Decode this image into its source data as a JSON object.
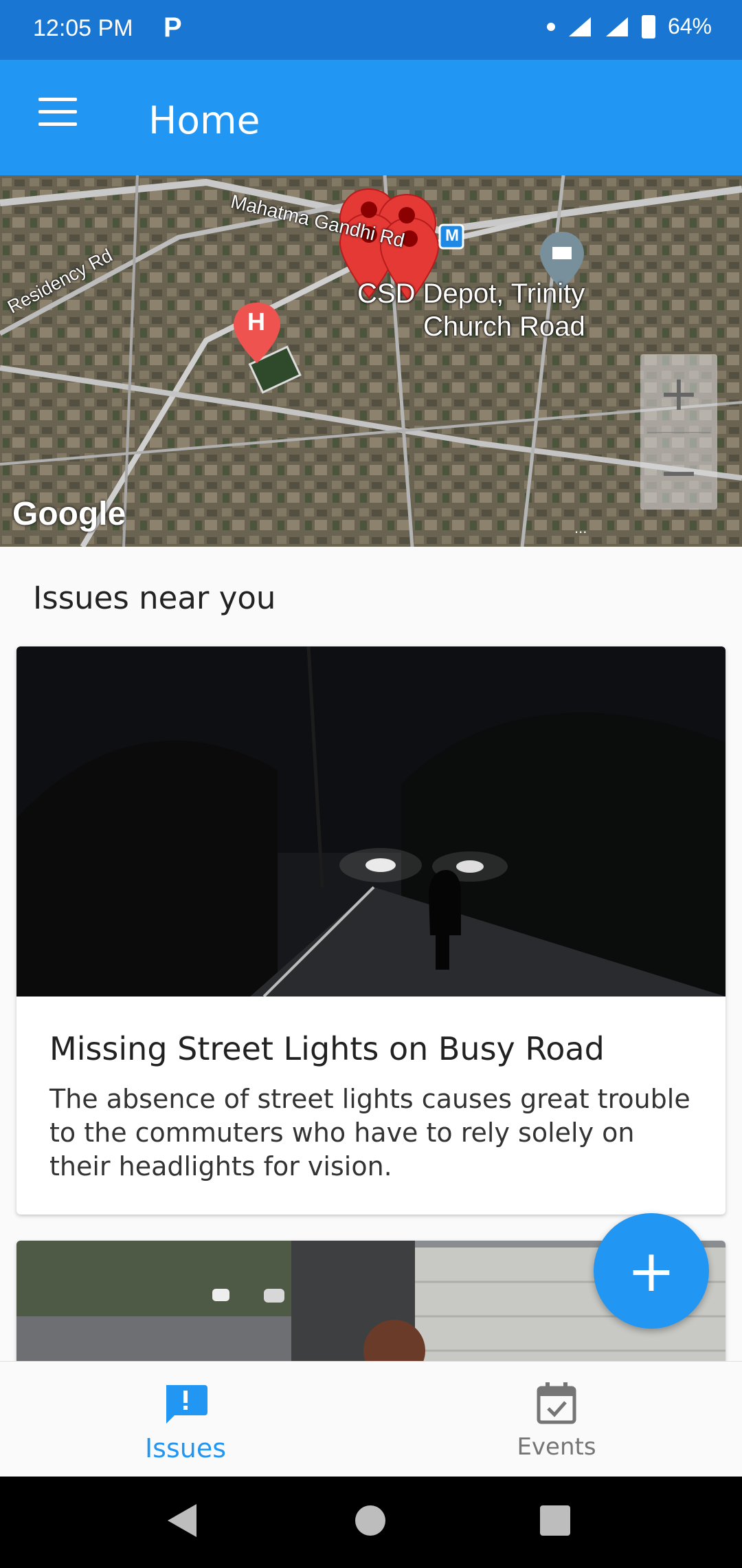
{
  "status_bar": {
    "time": "12:05 PM",
    "app_icon": "P",
    "battery": "64%"
  },
  "app_bar": {
    "title": "Home",
    "menu_icon": "hamburger-menu-icon"
  },
  "map": {
    "labels": {
      "road_1": "Mahatma Gandhi Rd",
      "road_2": "Residency Rd",
      "place": "CSD Depot, Trinity",
      "place_line2": "Church Road",
      "metro": "M",
      "hospital": "H"
    },
    "attribution": "Google",
    "zoom_in": "+",
    "zoom_out": "−",
    "more": "..."
  },
  "section": {
    "title": "Issues near you"
  },
  "issues": [
    {
      "title": "Missing Street Lights on Busy Road",
      "description": "The absence of street lights causes great trouble to the commuters who have to rely solely on their headlights for vision."
    }
  ],
  "fab": {
    "label": "+"
  },
  "bottom_nav": {
    "items": [
      {
        "label": "Issues",
        "icon": "issue-report-icon",
        "active": true
      },
      {
        "label": "Events",
        "icon": "calendar-check-icon",
        "active": false
      }
    ]
  },
  "colors": {
    "primary": "#2196f3",
    "primary_dark": "#1976d2",
    "marker": "#e53935"
  }
}
